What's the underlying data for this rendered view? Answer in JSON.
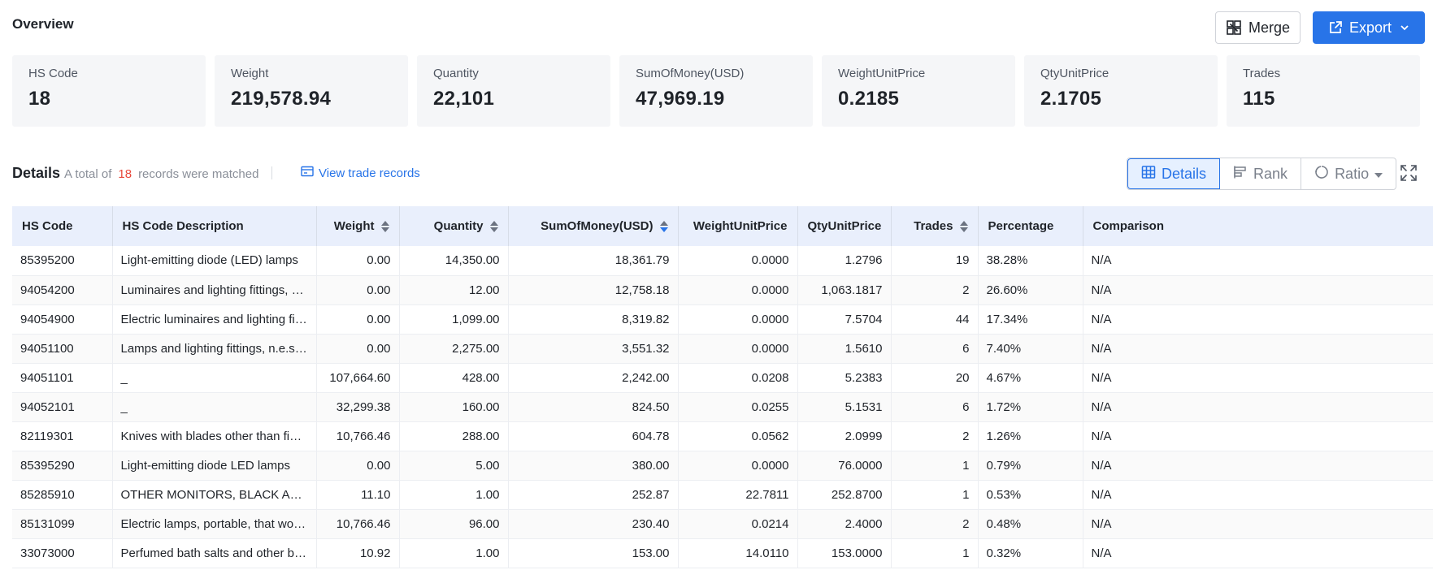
{
  "overview": {
    "title": "Overview",
    "merge_label": "Merge",
    "export_label": "Export"
  },
  "stats": [
    {
      "label": "HS Code",
      "value": "18"
    },
    {
      "label": "Weight",
      "value": "219,578.94"
    },
    {
      "label": "Quantity",
      "value": "22,101"
    },
    {
      "label": "SumOfMoney(USD)",
      "value": "47,969.19"
    },
    {
      "label": "WeightUnitPrice",
      "value": "0.2185"
    },
    {
      "label": "QtyUnitPrice",
      "value": "2.1705"
    },
    {
      "label": "Trades",
      "value": "115"
    }
  ],
  "details": {
    "title": "Details",
    "prefix": "A total of",
    "count": "18",
    "suffix": "records were matched",
    "view_records_label": "View trade records",
    "views": {
      "details": "Details",
      "rank": "Rank",
      "ratio": "Ratio"
    }
  },
  "table": {
    "headers": {
      "hs_code": "HS Code",
      "description": "HS Code Description",
      "weight": "Weight",
      "quantity": "Quantity",
      "sum": "SumOfMoney(USD)",
      "weight_unit_price": "WeightUnitPrice",
      "qty_unit_price": "QtyUnitPrice",
      "trades": "Trades",
      "percentage": "Percentage",
      "comparison": "Comparison"
    },
    "rows": [
      [
        "85395200",
        "Light-emitting diode (LED) lamps",
        "0.00",
        "14,350.00",
        "18,361.79",
        "0.0000",
        "1.2796",
        "19",
        "38.28%",
        "N/A"
      ],
      [
        "94054200",
        "Luminaires and lighting fittings, solely designed for use with LED light sources",
        "0.00",
        "12.00",
        "12,758.18",
        "0.0000",
        "1,063.1817",
        "2",
        "26.60%",
        "N/A"
      ],
      [
        "94054900",
        "Electric luminaires and lighting fixtures, n.e.s.",
        "0.00",
        "1,099.00",
        "8,319.82",
        "0.0000",
        "7.5704",
        "44",
        "17.34%",
        "N/A"
      ],
      [
        "94051100",
        "Lamps and lighting fittings, n.e.s; luminaires",
        "0.00",
        "2,275.00",
        "3,551.32",
        "0.0000",
        "1.5610",
        "6",
        "7.40%",
        "N/A"
      ],
      [
        "94051101",
        "_",
        "107,664.60",
        "428.00",
        "2,242.00",
        "0.0208",
        "5.2383",
        "20",
        "4.67%",
        "N/A"
      ],
      [
        "94052101",
        "_",
        "32,299.38",
        "160.00",
        "824.50",
        "0.0255",
        "5.1531",
        "6",
        "1.72%",
        "N/A"
      ],
      [
        "82119301",
        "Knives with blades other than fixed blades",
        "10,766.46",
        "288.00",
        "604.78",
        "0.0562",
        "2.0999",
        "2",
        "1.26%",
        "N/A"
      ],
      [
        "85395290",
        "Light-emitting diode LED lamps",
        "0.00",
        "5.00",
        "380.00",
        "0.0000",
        "76.0000",
        "1",
        "0.79%",
        "N/A"
      ],
      [
        "85285910",
        "OTHER MONITORS, BLACK AND WHITE OR OTHER MONOCHROME",
        "11.10",
        "1.00",
        "252.87",
        "22.7811",
        "252.8700",
        "1",
        "0.53%",
        "N/A"
      ],
      [
        "85131099",
        "Electric lamps, portable, that work with their own source of energy",
        "10,766.46",
        "96.00",
        "230.40",
        "0.0214",
        "2.4000",
        "2",
        "0.48%",
        "N/A"
      ],
      [
        "33073000",
        "Perfumed bath salts and other bath preparations",
        "10.92",
        "1.00",
        "153.00",
        "14.0110",
        "153.0000",
        "1",
        "0.32%",
        "N/A"
      ]
    ]
  },
  "colors": {
    "accent": "#2874e8",
    "count": "#e8483b",
    "header_bg": "#e9effc",
    "card_bg": "#f5f6f8"
  },
  "icons": {
    "merge": "merge-icon",
    "export": "export-icon",
    "view_records": "records-icon",
    "details": "grid-icon",
    "rank": "rank-icon",
    "ratio": "ratio-icon",
    "fullscreen": "fullscreen-icon"
  }
}
